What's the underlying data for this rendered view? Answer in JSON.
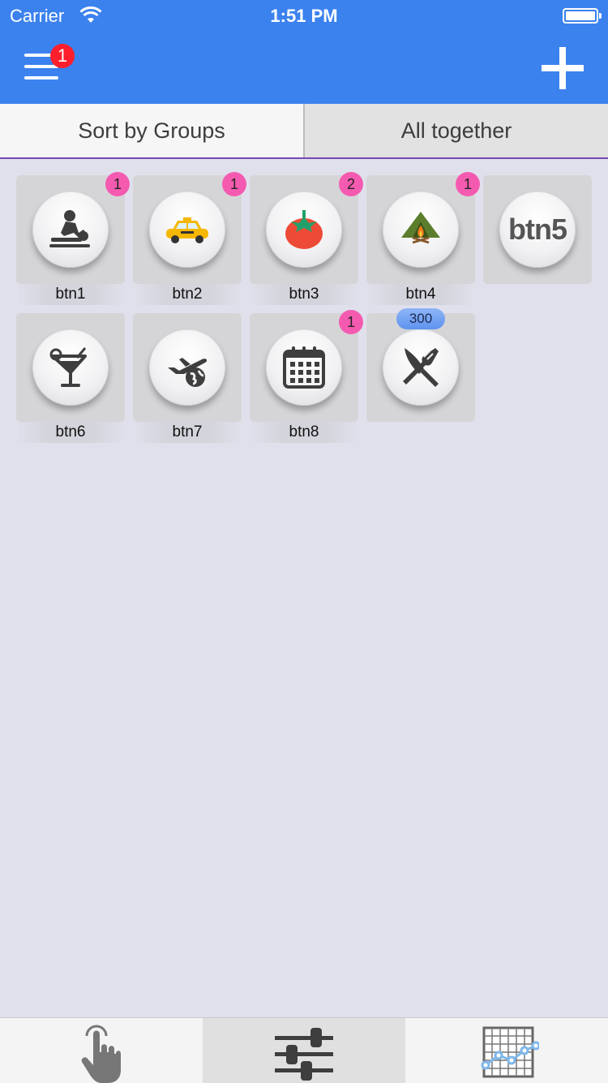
{
  "status_bar": {
    "carrier": "Carrier",
    "time": "1:51 PM",
    "wifi_icon": "wifi-icon",
    "battery_icon": "battery-icon"
  },
  "nav": {
    "menu_icon": "hamburger-menu-icon",
    "menu_badge": "1",
    "add_icon": "plus-icon"
  },
  "tabs": [
    {
      "label": "Sort by Groups",
      "selected": true
    },
    {
      "label": "All together",
      "selected": false
    }
  ],
  "buttons": [
    {
      "label": "btn1",
      "icon": "massage-icon",
      "badge": "1"
    },
    {
      "label": "btn2",
      "icon": "taxi-icon",
      "badge": "1"
    },
    {
      "label": "btn3",
      "icon": "tomato-icon",
      "badge": "2"
    },
    {
      "label": "btn4",
      "icon": "campfire-tent-icon",
      "badge": "1"
    },
    {
      "label": "",
      "icon_text": "btn5",
      "badge": ""
    },
    {
      "label": "btn6",
      "icon": "cocktail-icon",
      "badge": ""
    },
    {
      "label": "btn7",
      "icon": "airplane-globe-icon",
      "badge": ""
    },
    {
      "label": "btn8",
      "icon": "calendar-icon",
      "badge": "1"
    },
    {
      "label": "",
      "icon": "fork-knife-icon",
      "badge": "300"
    }
  ],
  "tab_bar": [
    {
      "icon": "hand-tap-icon",
      "selected": false
    },
    {
      "icon": "sliders-icon",
      "selected": true
    },
    {
      "icon": "chart-grid-icon",
      "selected": false
    }
  ],
  "colors": {
    "nav": "#3b82ee",
    "badge_pink": "#f45bb0",
    "badge_blue": "#6a9cf0",
    "badge_red": "#ff1f2c",
    "background": "#e0e0ec"
  }
}
